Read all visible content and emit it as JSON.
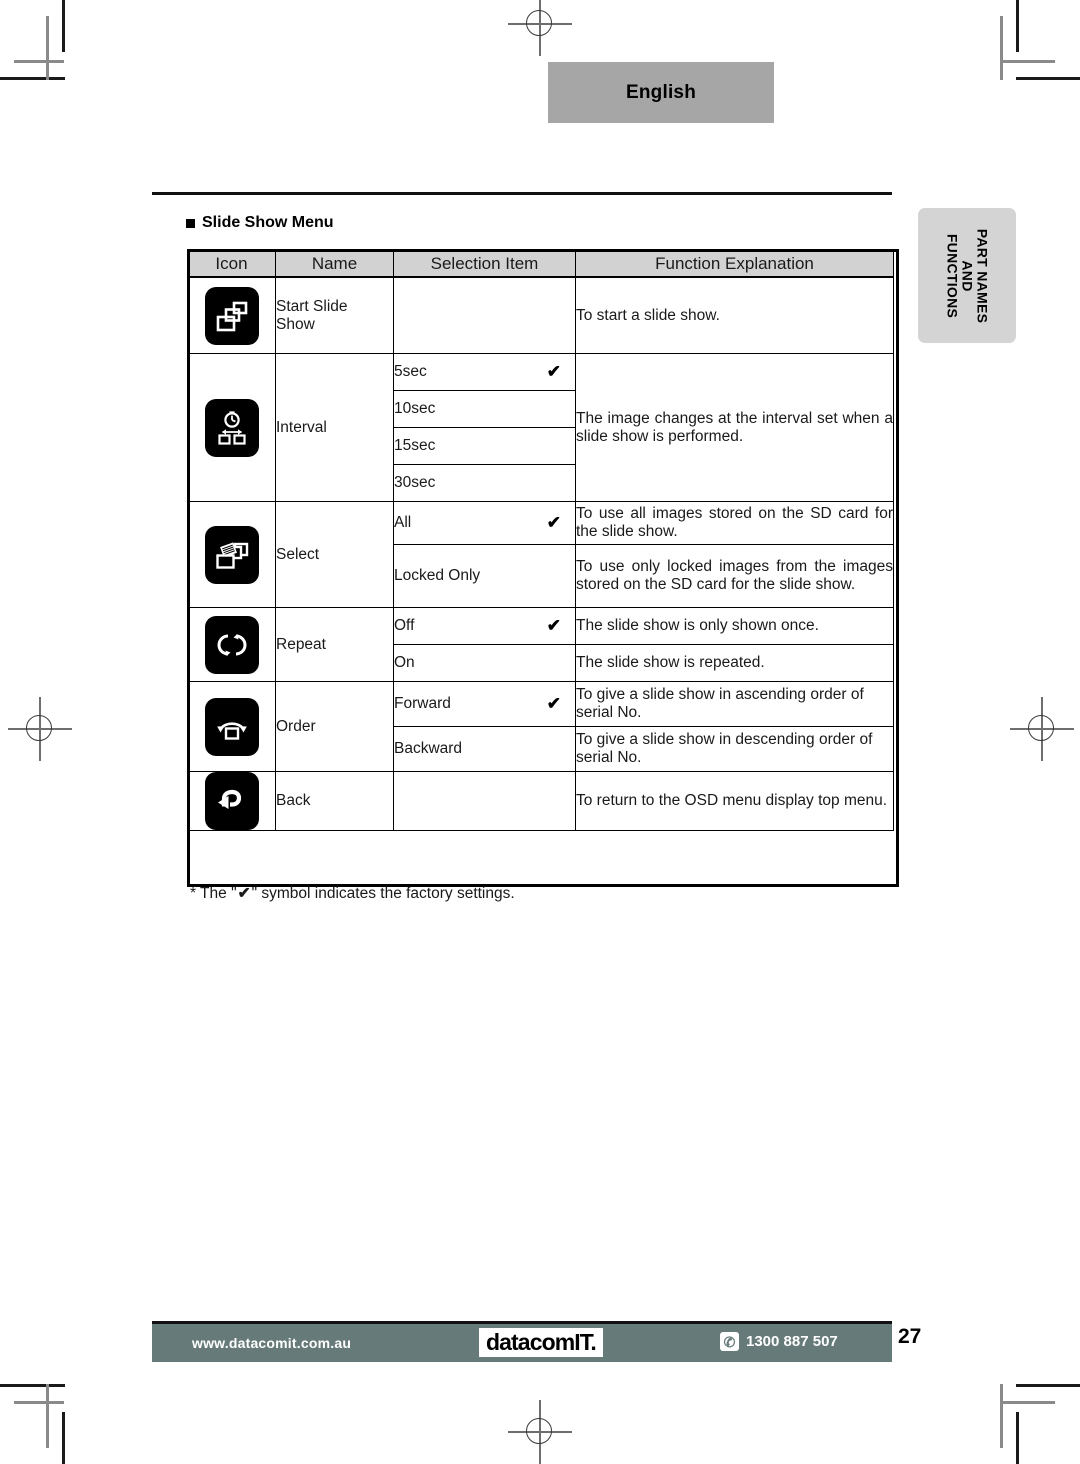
{
  "language_tab": {
    "label": "English"
  },
  "side_tab": {
    "label": "PART NAMES AND FUNCTIONS"
  },
  "section": {
    "heading": "Slide Show Menu"
  },
  "table": {
    "headers": [
      "Icon",
      "Name",
      "Selection Item",
      "Function Explanation"
    ],
    "rows": [
      {
        "icon": "cascading-slides-icon",
        "name": "Start Slide Show",
        "selections": [
          {
            "label": "",
            "checked": false,
            "explanation": "To start a slide show."
          }
        ]
      },
      {
        "icon": "stopwatch-interval-icon",
        "name": "Interval",
        "explanation": "The image changes at the interval set when a slide show is performed.",
        "selections": [
          {
            "label": "5sec",
            "checked": true
          },
          {
            "label": "10sec",
            "checked": false
          },
          {
            "label": "15sec",
            "checked": false
          },
          {
            "label": "30sec",
            "checked": false
          }
        ]
      },
      {
        "icon": "select-images-icon",
        "name": "Select",
        "selections": [
          {
            "label": "All",
            "checked": true,
            "explanation": "To use all images stored on the SD card for the slide show."
          },
          {
            "label": "Locked Only",
            "checked": false,
            "explanation": "To use only locked images from the images stored on the SD card for the slide show."
          }
        ]
      },
      {
        "icon": "repeat-loop-icon",
        "name": "Repeat",
        "selections": [
          {
            "label": "Off",
            "checked": true,
            "explanation": "The slide show is only shown once."
          },
          {
            "label": "On",
            "checked": false,
            "explanation": "The slide show is repeated."
          }
        ]
      },
      {
        "icon": "order-arrow-icon",
        "name": "Order",
        "selections": [
          {
            "label": "Forward",
            "checked": true,
            "explanation": "To give a slide show in ascending order of serial No."
          },
          {
            "label": "Backward",
            "checked": false,
            "explanation": "To give a slide show in descending order of serial No."
          }
        ]
      },
      {
        "icon": "back-return-icon",
        "name": "Back",
        "selections": [
          {
            "label": "",
            "checked": false,
            "explanation": "To return to the OSD menu display top menu."
          }
        ]
      }
    ]
  },
  "footnote": {
    "prefix": "* The \"",
    "mark": "✔",
    "suffix": "\" symbol indicates the factory settings."
  },
  "footer": {
    "url": "www.datacomit.com.au",
    "logo": "datacomIT.",
    "phone": "1300 887 507",
    "phone_icon": "phone-icon",
    "page_number": "27"
  },
  "colors": {
    "header_fill": "#d2d2d2",
    "lang_tab_fill": "#a6a6a6",
    "side_tab_fill": "#d4d4d4",
    "banner_fill": "#667a7a"
  },
  "check_glyph": "✔"
}
